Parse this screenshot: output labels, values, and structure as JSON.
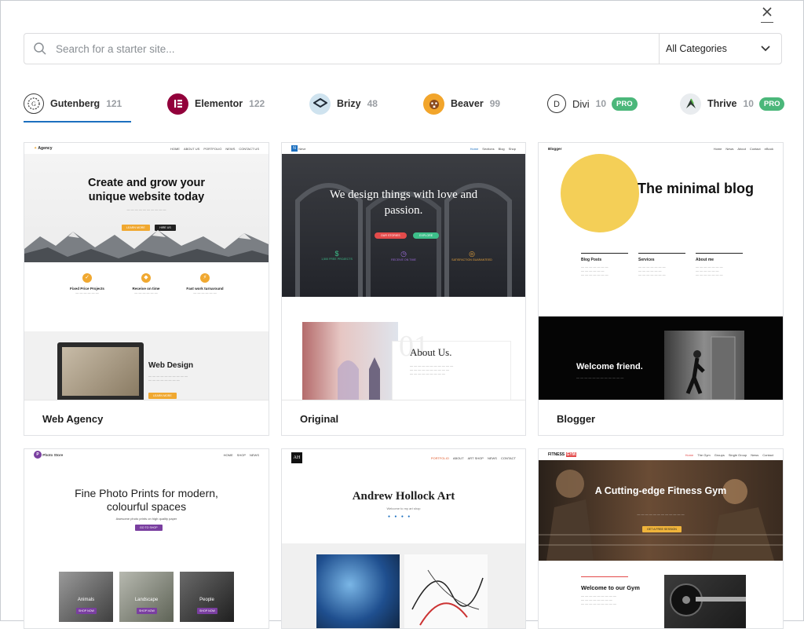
{
  "search": {
    "placeholder": "Search for a starter site..."
  },
  "category_select": {
    "label": "All Categories"
  },
  "builders": [
    {
      "name": "Gutenberg",
      "count": "121",
      "pro": ""
    },
    {
      "name": "Elementor",
      "count": "122",
      "pro": ""
    },
    {
      "name": "Brizy",
      "count": "48",
      "pro": ""
    },
    {
      "name": "Beaver",
      "count": "99",
      "pro": ""
    },
    {
      "name": "Divi",
      "count": "10",
      "pro": "PRO"
    },
    {
      "name": "Thrive",
      "count": "10",
      "pro": "PRO"
    }
  ],
  "sites": [
    {
      "title": "Web Agency",
      "preview": {
        "brand": "Agency",
        "nav": [
          "HOME",
          "ABOUT US",
          "PORTFOLIO",
          "NEWS",
          "CONTACT US"
        ],
        "headline": "Create and grow your unique website today",
        "btn1": "LEARN MORE",
        "btn2": "HIRE US",
        "features": [
          "Fixed Price Projects",
          "Receive on time",
          "Fast work turnaround"
        ],
        "section": "Web Design",
        "cta": "LEARN MORE"
      }
    },
    {
      "title": "Original",
      "preview": {
        "brand": "Neve",
        "nav": [
          "Home",
          "Sections",
          "Blog",
          "Shop"
        ],
        "headline": "We design things with love and passion.",
        "btn1": "OUR STORIES",
        "btn2": "EXPLORE",
        "features": [
          "1,500 FREE PROJECTS",
          "RECEIVE ON TIME",
          "SATISFACTION GUARANTEED"
        ],
        "number": "01",
        "section": "About Us."
      }
    },
    {
      "title": "Blogger",
      "preview": {
        "brand": "Blogger",
        "nav": [
          "Home",
          "News",
          "About",
          "Contact",
          "eBook"
        ],
        "headline": "The minimal blog",
        "cols": [
          "Blog Posts",
          "Services",
          "About me"
        ],
        "banner": "Welcome friend."
      }
    },
    {
      "title": "",
      "preview": {
        "brand": "Photo Store",
        "nav": [
          "HOME",
          "SHOP",
          "NEWS"
        ],
        "headline": "Fine Photo Prints for modern, colourful spaces",
        "sub": "Awesome photo prints on high quality paper",
        "btn": "GO TO SHOP",
        "cats": [
          "Animals",
          "Landscape",
          "People"
        ],
        "cat_btn": "SHOP NOW"
      }
    },
    {
      "title": "",
      "preview": {
        "brand": "AH",
        "nav": [
          "PORTFOLIO",
          "ABOUT",
          "ART SHOP",
          "NEWS",
          "CONTACT"
        ],
        "headline": "Andrew Hollock Art",
        "sub": "Welcome to my art shop"
      }
    },
    {
      "title": "",
      "preview": {
        "brand": "FITNESS",
        "brand2": "GYM",
        "nav": [
          "Home",
          "The Gym",
          "Groups",
          "Single Group",
          "News",
          "Contact"
        ],
        "headline": "A Cutting-edge Fitness Gym",
        "btn": "GET A FREE SESSION",
        "section": "Welcome to our Gym"
      }
    }
  ],
  "colors": {
    "accent": "#1c6fbf",
    "pro_badge": "#4bb77a",
    "agency_yellow": "#f0a830",
    "blogger_yellow": "#f4cf57",
    "gym_orange": "#f0b43b"
  }
}
